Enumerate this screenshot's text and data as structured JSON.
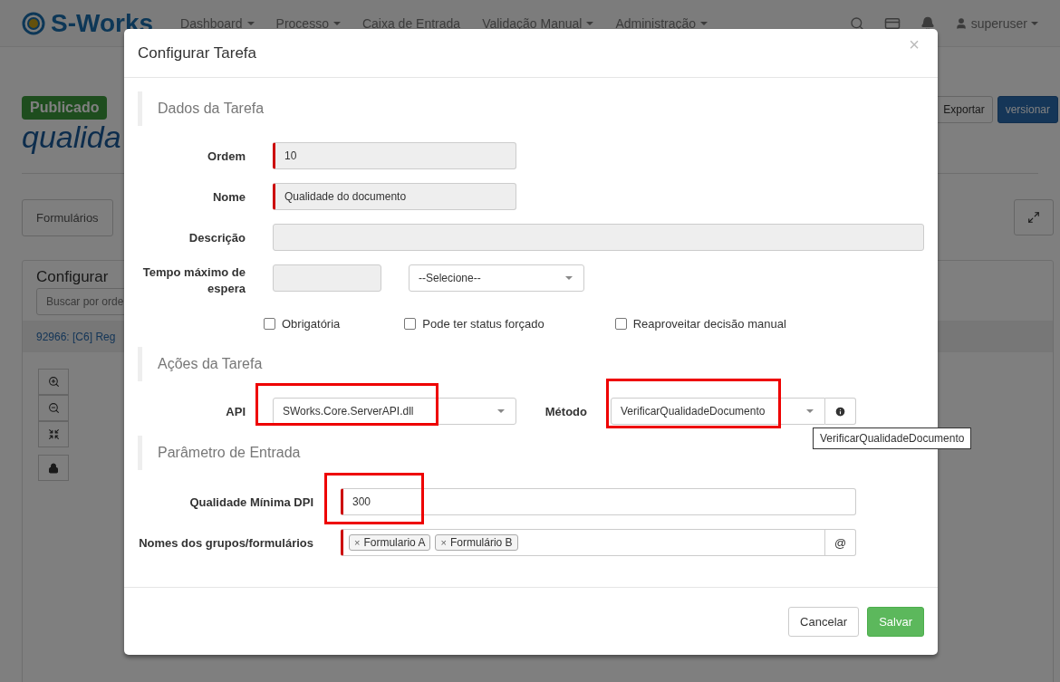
{
  "navbar": {
    "brand": "S-Works",
    "menu": [
      {
        "label": "Dashboard",
        "dropdown": true
      },
      {
        "label": "Processo",
        "dropdown": true
      },
      {
        "label": "Caixa de Entrada",
        "dropdown": false
      },
      {
        "label": "Validação Manual",
        "dropdown": true
      },
      {
        "label": "Administração",
        "dropdown": true
      }
    ],
    "user": "superuser"
  },
  "page": {
    "status_badge": "Publicado",
    "title": "qualida",
    "actions": [
      {
        "label": "Exportar",
        "kind": "default"
      },
      {
        "label": "versionar",
        "kind": "primary"
      }
    ],
    "tab": "Formulários",
    "panel": {
      "title": "Configurar",
      "search_placeholder": "Buscar por orde",
      "row": "92966: [C6] Reg"
    }
  },
  "modal": {
    "title": "Configurar Tarefa",
    "close": "×",
    "task_data": {
      "heading": "Dados da Tarefa",
      "fields": [
        {
          "kind": "short",
          "label": "Ordem",
          "value": "10",
          "required": true
        },
        {
          "kind": "short",
          "label": "Nome",
          "value": "Qualidade do documento",
          "required": true
        },
        {
          "kind": "wide",
          "label": "Descrição",
          "required": false
        }
      ],
      "timeout": {
        "label": "Tempo máximo de espera",
        "unit": "--Selecione--"
      },
      "checkboxes": [
        {
          "label": "Obrigatória",
          "checked": false
        },
        {
          "label": "Pode ter status forçado",
          "checked": false
        },
        {
          "label": "Reaproveitar decisão manual",
          "checked": false
        }
      ]
    },
    "actions": {
      "heading": "Ações da Tarefa",
      "api": {
        "label": "API",
        "value": "SWorks.Core.ServerAPI.dll",
        "highlighted": true
      },
      "method": {
        "label": "Método",
        "value": "VerificarQualidadeDocumento",
        "highlighted": true,
        "tooltip": "VerificarQualidadeDocumento"
      }
    },
    "input_params": {
      "heading": "Parâmetro de Entrada",
      "fields": [
        {
          "kind": "text",
          "label": "Qualidade Mínima DPI",
          "value": "300",
          "required": true,
          "highlighted": true
        },
        {
          "kind": "tags",
          "label": "Nomes dos grupos/formulários",
          "required": true,
          "highlighted": false,
          "addon": "@",
          "tags": [
            {
              "remove": "×",
              "label": "Formulario A"
            },
            {
              "remove": "×",
              "label": "Formulário B"
            }
          ]
        }
      ]
    },
    "footer": [
      {
        "label": "Cancelar",
        "kind": "default"
      },
      {
        "label": "Salvar",
        "kind": "primary"
      }
    ]
  }
}
